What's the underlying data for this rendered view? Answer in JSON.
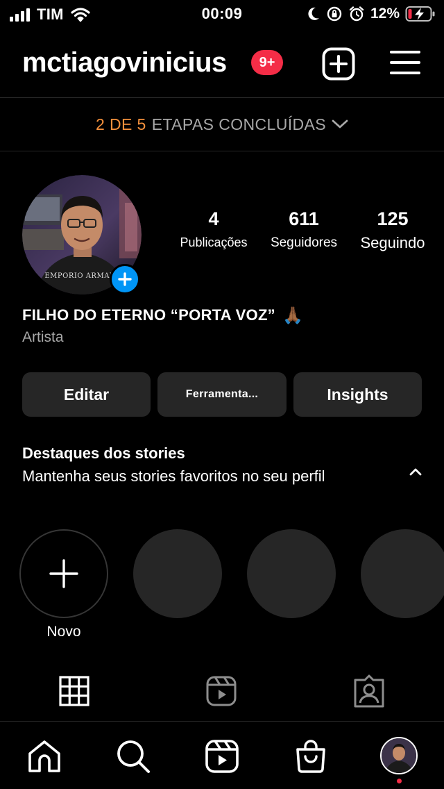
{
  "status_bar": {
    "carrier": "TIM",
    "time": "00:09",
    "battery_percent": "12%",
    "icons": [
      "signal-icon",
      "wifi-icon",
      "moon-icon",
      "orientation-lock-icon",
      "alarm-icon",
      "battery-charging-icon"
    ]
  },
  "header": {
    "username": "mctiagovinicius",
    "notification_badge": "9+",
    "new_post_icon": "plus-square-icon",
    "menu_icon": "hamburger-menu-icon"
  },
  "steps_banner": {
    "done_text": "2 DE 5",
    "rest_text": "ETAPAS CONCLUÍDAS",
    "icon": "chevron-down-icon"
  },
  "profile": {
    "stats": [
      {
        "value": "4",
        "label": "Publicações"
      },
      {
        "value": "611",
        "label": "Seguidores"
      },
      {
        "value": "125",
        "label": "Seguindo"
      }
    ],
    "name": "FILHO DO ETERNO “PORTA VOZ”",
    "name_emoji": "🙏🏾",
    "category": "Artista",
    "avatar_shirt_text": "EMPORIO ARMANI"
  },
  "actions": {
    "edit": "Editar",
    "tools": "Ferramenta...",
    "insights": "Insights"
  },
  "highlights": {
    "title": "Destaques dos stories",
    "description": "Mantenha seus stories favoritos no seu perfil",
    "new_label": "Novo",
    "toggle_icon": "chevron-up-icon"
  },
  "tabs": [
    "grid-icon",
    "reels-icon",
    "tagged-icon"
  ],
  "bottom_nav": [
    "home-icon",
    "search-icon",
    "reels-icon",
    "shop-icon",
    "profile-avatar"
  ],
  "colors": {
    "background": "#000000",
    "accent_orange": "#f7923d",
    "badge_red": "#f42d47",
    "blue": "#0095f6",
    "button_bg": "#262626",
    "muted_text": "#a8a8a8"
  }
}
